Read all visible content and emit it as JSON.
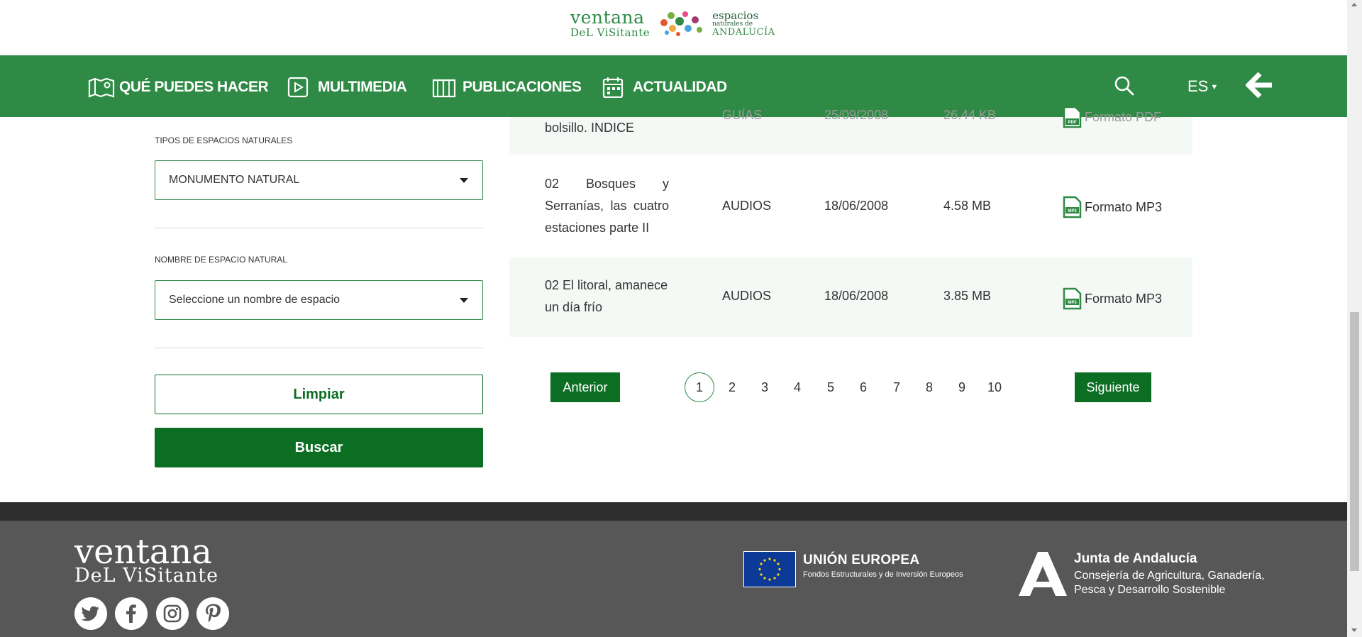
{
  "header": {
    "logo_line1": "ventana",
    "logo_line2": "DeL ViSitante",
    "partner_line1": "espacios",
    "partner_line2": "naturales de",
    "partner_line3": "ANDALUCÍA"
  },
  "nav": {
    "items": [
      {
        "label": "QUÉ PUEDES HACER",
        "icon": "map-pin-icon"
      },
      {
        "label": "MULTIMEDIA",
        "icon": "play-icon"
      },
      {
        "label": "PUBLICACIONES",
        "icon": "book-icon"
      },
      {
        "label": "ACTUALIDAD",
        "icon": "calendar-icon"
      }
    ],
    "search_icon": "search-icon",
    "language": "ES",
    "back_icon": "arrow-left-icon"
  },
  "filters": {
    "type_label": "TIPOS DE ESPACIOS NATURALES",
    "type_value": "MONUMENTO NATURAL",
    "name_label": "NOMBRE DE ESPACIO NATURAL",
    "name_placeholder": "Seleccione un nombre de espacio",
    "clear_label": "Limpiar",
    "search_label": "Buscar"
  },
  "results": [
    {
      "title_l1": "bolsillo. INDICE",
      "category": "GUÍAS",
      "date": "25/09/2008",
      "size": "26.44 KB",
      "format": "Formato PDF",
      "file_type": "PDF"
    },
    {
      "title_l1": "02 Bosques y",
      "title_l2": "Serranías, las cuatro",
      "title_l3": "estaciones parte II",
      "category": "AUDIOS",
      "date": "18/06/2008",
      "size": "4.58 MB",
      "format": "Formato MP3",
      "file_type": "MP3"
    },
    {
      "title_l1": "02 El litoral, amanece",
      "title_l2": "un día frío",
      "category": "AUDIOS",
      "date": "18/06/2008",
      "size": "3.85 MB",
      "format": "Formato MP3",
      "file_type": "MP3"
    }
  ],
  "pagination": {
    "prev_label": "Anterior",
    "next_label": "Siguiente",
    "pages": [
      "1",
      "2",
      "3",
      "4",
      "5",
      "6",
      "7",
      "8",
      "9",
      "10"
    ],
    "current": "1"
  },
  "footer": {
    "logo_line1": "ventana",
    "logo_line2": "DeL ViSitante",
    "social": [
      "twitter-icon",
      "facebook-icon",
      "instagram-icon",
      "pinterest-icon"
    ],
    "eu_title": "UNIÓN EUROPEA",
    "eu_subtitle": "Fondos Estructurales y de Inversión Europeos",
    "junta_title": "Junta de Andalucía",
    "junta_line1": "Consejería de Agricultura, Ganadería,",
    "junta_line2": "Pesca y Desarrollo Sostenible"
  },
  "colors": {
    "brand_green": "#2e8a44",
    "button_green": "#0b6e23",
    "footer_gray": "#575757"
  }
}
